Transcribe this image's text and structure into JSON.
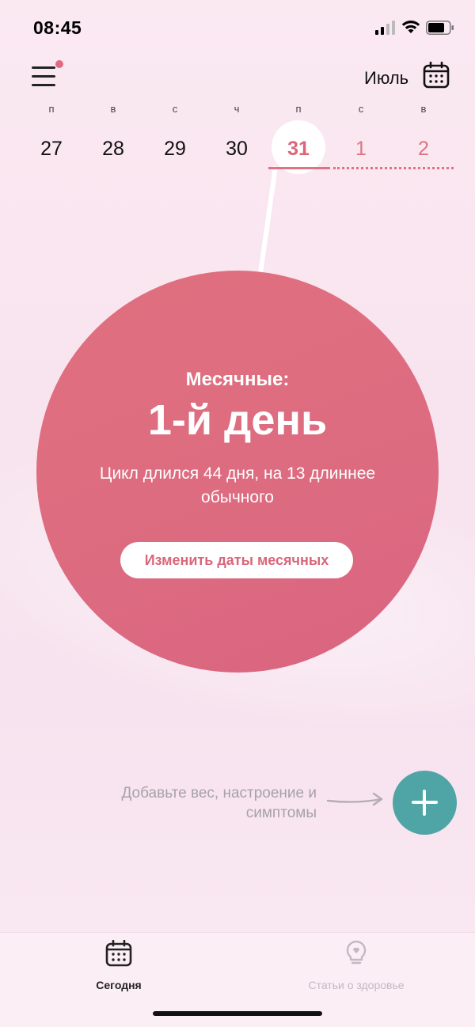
{
  "status_bar": {
    "time": "08:45"
  },
  "header": {
    "month": "Июль"
  },
  "week": {
    "days": [
      {
        "dow": "п",
        "num": "27"
      },
      {
        "dow": "в",
        "num": "28"
      },
      {
        "dow": "с",
        "num": "29"
      },
      {
        "dow": "ч",
        "num": "30"
      },
      {
        "dow": "п",
        "num": "31"
      },
      {
        "dow": "с",
        "num": "1"
      },
      {
        "dow": "в",
        "num": "2"
      }
    ]
  },
  "cycle": {
    "label": "Месячные:",
    "day": "1-й день",
    "info": "Цикл длился 44 дня, на 13 длиннее обычного",
    "edit_button": "Изменить даты месячных"
  },
  "add": {
    "hint": "Добавьте вес, настроение и симптомы"
  },
  "tabs": [
    {
      "label": "Сегодня"
    },
    {
      "label": "Статьи о здоровье"
    }
  ],
  "colors": {
    "accent": "#dd6577",
    "circle": "#de6c80",
    "fab": "#4fa5a6"
  }
}
